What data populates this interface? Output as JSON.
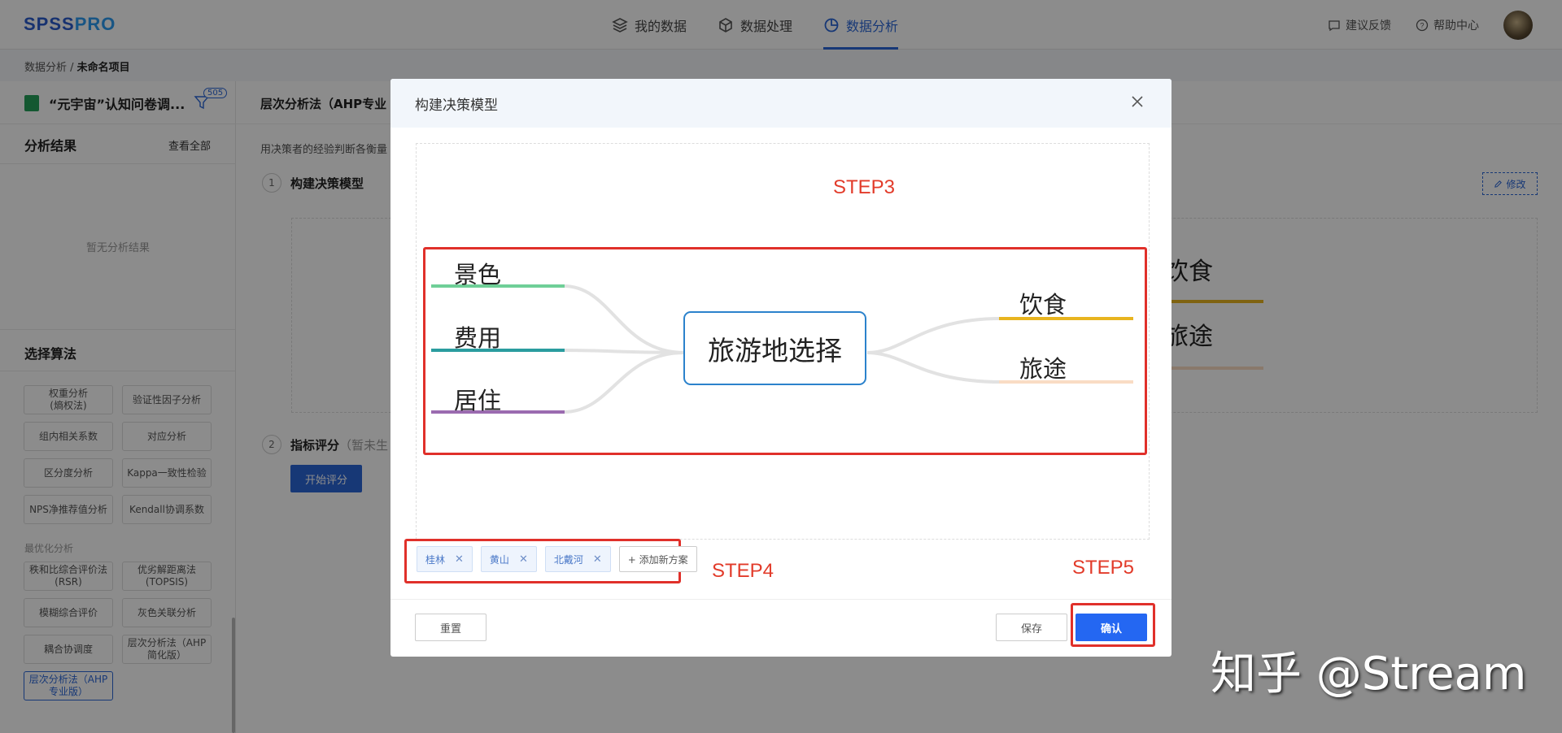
{
  "app": {
    "logo_a": "SPSS",
    "logo_b": "PRO"
  },
  "nav": [
    {
      "label": "我的数据",
      "icon": "layers-icon"
    },
    {
      "label": "数据处理",
      "icon": "cube-icon"
    },
    {
      "label": "数据分析",
      "icon": "pie-chart-icon",
      "active": true
    }
  ],
  "top_right": {
    "feedback": "建议反馈",
    "help": "帮助中心"
  },
  "breadcrumb": {
    "root": "数据分析 / ",
    "current": "未命名项目"
  },
  "sidebar": {
    "file_name": "“元宇宙”认知问卷调...",
    "filter_count": "505",
    "results_title": "分析结果",
    "view_all": "查看全部",
    "empty_text": "暂无分析结果",
    "algo_title": "选择算法",
    "algos_top": [
      "权重分析\n(熵权法)",
      "验证性因子分析",
      "组内相关系数",
      "对应分析",
      "区分度分析",
      "Kappa一致性检验",
      "NPS净推荐值分析",
      "Kendall协调系数"
    ],
    "group_label": "最优化分析",
    "algos_bottom": [
      "秩和比综合评价法\n(RSR)",
      "优劣解距离法\n(TOPSIS)",
      "模糊综合评价",
      "灰色关联分析",
      "耦合协调度",
      "层次分析法（AHP\n简化版）",
      "层次分析法（AHP\n专业版）"
    ]
  },
  "main": {
    "title": "层次分析法（AHP专业",
    "desc": "用决策者的经验判断各衡量",
    "step1_no": "1",
    "step1_title": "构建决策模型",
    "edit": "修改",
    "bg_labels": [
      "饮食",
      "旅途"
    ],
    "step2_no": "2",
    "step2_title": "指标评分",
    "step2_hint": "（暂未生",
    "start_score": "开始评分"
  },
  "modal": {
    "title": "构建决策模型",
    "step3": "STEP3",
    "step4": "STEP4",
    "step5": "STEP5",
    "center": "旅游地选择",
    "left_nodes": [
      {
        "label": "景色",
        "color": "#6fcf97"
      },
      {
        "label": "费用",
        "color": "#2a9d9f"
      },
      {
        "label": "居住",
        "color": "#9b6bb0"
      }
    ],
    "right_nodes": [
      {
        "label": "饮食",
        "color": "#e8b41f"
      },
      {
        "label": "旅途",
        "color": "#f9dcc4"
      }
    ],
    "chips": [
      "桂林",
      "黄山",
      "北戴河"
    ],
    "add_chip": "+ 添加新方案",
    "reset": "重置",
    "save": "保存",
    "confirm": "确认"
  },
  "watermark": "知乎 @Stream"
}
